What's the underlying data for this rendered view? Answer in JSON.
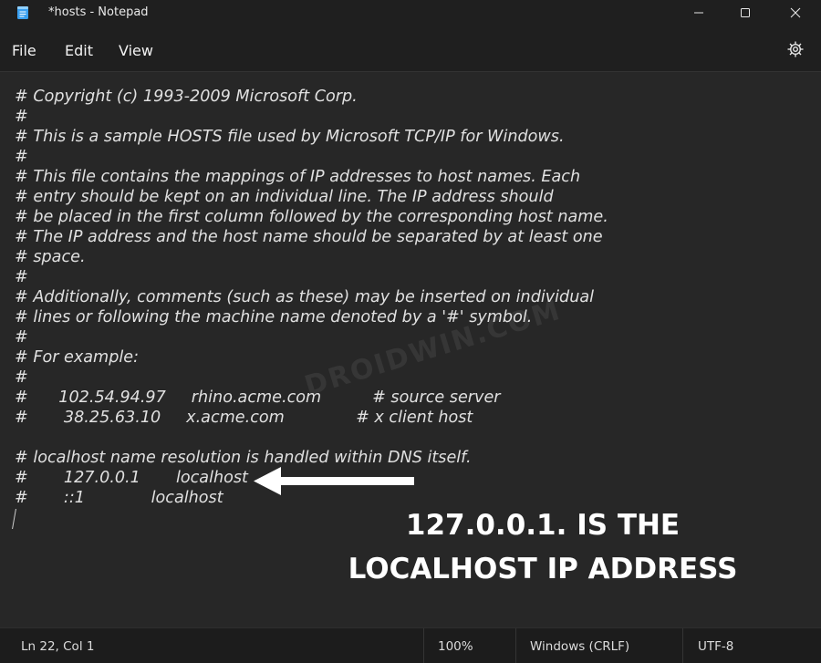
{
  "window": {
    "title": "*hosts - Notepad"
  },
  "menu": {
    "file": "File",
    "edit": "Edit",
    "view": "View"
  },
  "editor": {
    "lines": [
      "# Copyright (c) 1993-2009 Microsoft Corp.",
      "#",
      "# This is a sample HOSTS file used by Microsoft TCP/IP for Windows.",
      "#",
      "# This file contains the mappings of IP addresses to host names. Each",
      "# entry should be kept on an individual line. The IP address should",
      "# be placed in the first column followed by the corresponding host name.",
      "# The IP address and the host name should be separated by at least one",
      "# space.",
      "#",
      "# Additionally, comments (such as these) may be inserted on individual",
      "# lines or following the machine name denoted by a '#' symbol.",
      "#",
      "# For example:",
      "#",
      "#      102.54.94.97     rhino.acme.com          # source server",
      "#       38.25.63.10     x.acme.com              # x client host",
      "",
      "# localhost name resolution is handled within DNS itself.",
      "#       127.0.0.1       localhost",
      "#       ::1             localhost"
    ]
  },
  "annotation": {
    "line1": "127.0.0.1. IS THE",
    "line2": "LOCALHOST IP ADDRESS",
    "watermark": "DROIDWIN.COM"
  },
  "status": {
    "position": "Ln 22, Col 1",
    "zoom": "100%",
    "line_ending": "Windows (CRLF)",
    "encoding": "UTF-8"
  },
  "colors": {
    "background": "#1f1f1f",
    "editor_bg": "#272727",
    "text": "#e0e0e0"
  },
  "icons": {
    "app": "notepad-icon",
    "settings": "gear-icon",
    "minimize": "minimize-icon",
    "maximize": "maximize-icon",
    "close": "close-icon"
  }
}
